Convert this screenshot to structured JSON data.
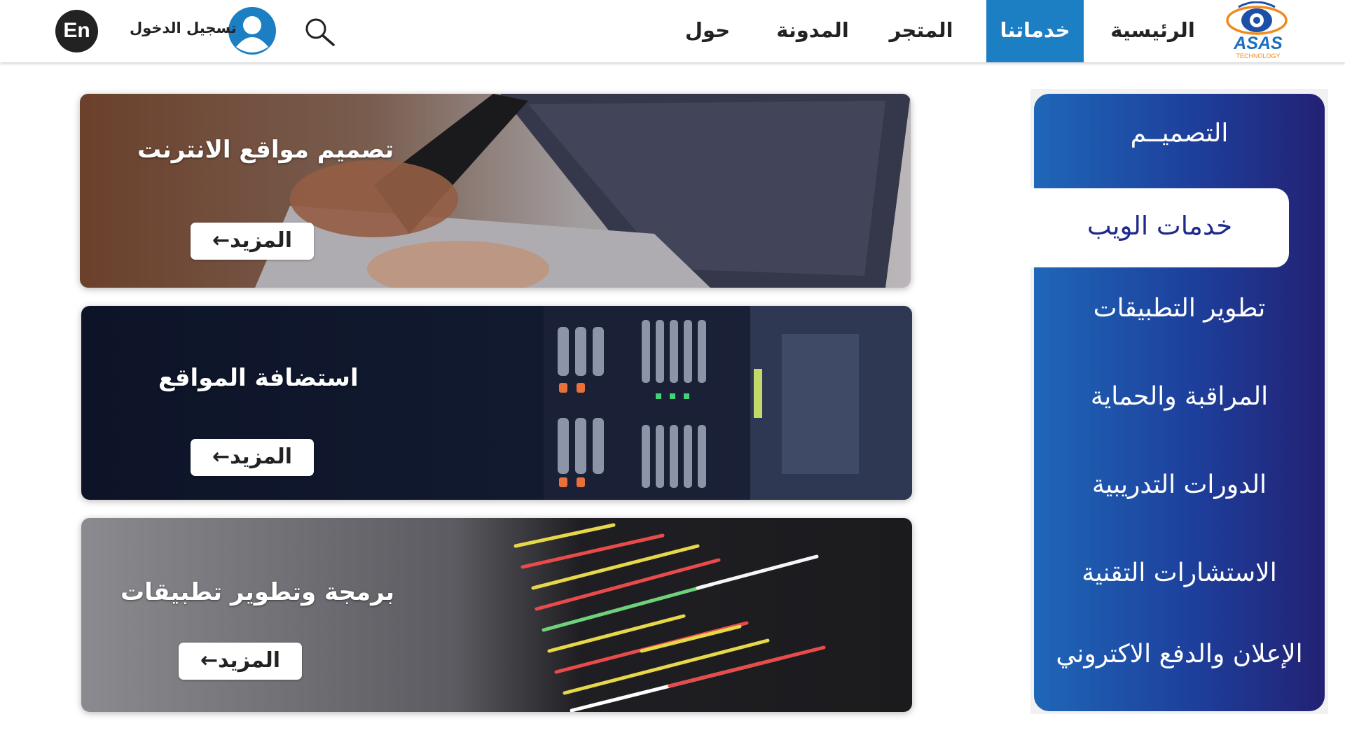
{
  "header": {
    "logo_text": "ASAS",
    "logo_subtext": "TECHNOLOGY",
    "nav": [
      {
        "label": "الرئيسية",
        "active": false
      },
      {
        "label": "خدماتنا",
        "active": true
      },
      {
        "label": "المتجر",
        "active": false
      },
      {
        "label": "المدونة",
        "active": false
      },
      {
        "label": "حول",
        "active": false
      }
    ],
    "search_icon": "search-icon",
    "login_label": "تسجيل الدخول",
    "user_icon": "user-avatar-icon",
    "lang_label": "En"
  },
  "cards": [
    {
      "title": "تصميم مواقع الانترنت",
      "button": "المزيد←"
    },
    {
      "title": "استضافة المواقع",
      "button": "المزيد←"
    },
    {
      "title": "برمجة وتطوير تطبيقات",
      "button": "المزيد←"
    }
  ],
  "side_menu": {
    "items": [
      {
        "label": "التصميــم",
        "active": false
      },
      {
        "label": "خدمات الويب",
        "active": true
      },
      {
        "label": "تطوير التطبيقات",
        "active": false
      },
      {
        "label": "المراقبة والحماية",
        "active": false
      },
      {
        "label": "الدورات التدريبية",
        "active": false
      },
      {
        "label": "الاستشارات التقنية",
        "active": false
      },
      {
        "label": "الإعلان والدفع الاكتروني",
        "active": false
      }
    ]
  },
  "colors": {
    "accent": "#1c7ec3",
    "menu_gradient_start": "#1f67b8",
    "menu_gradient_end": "#232173",
    "active_menu_text": "#1d2a8a"
  }
}
